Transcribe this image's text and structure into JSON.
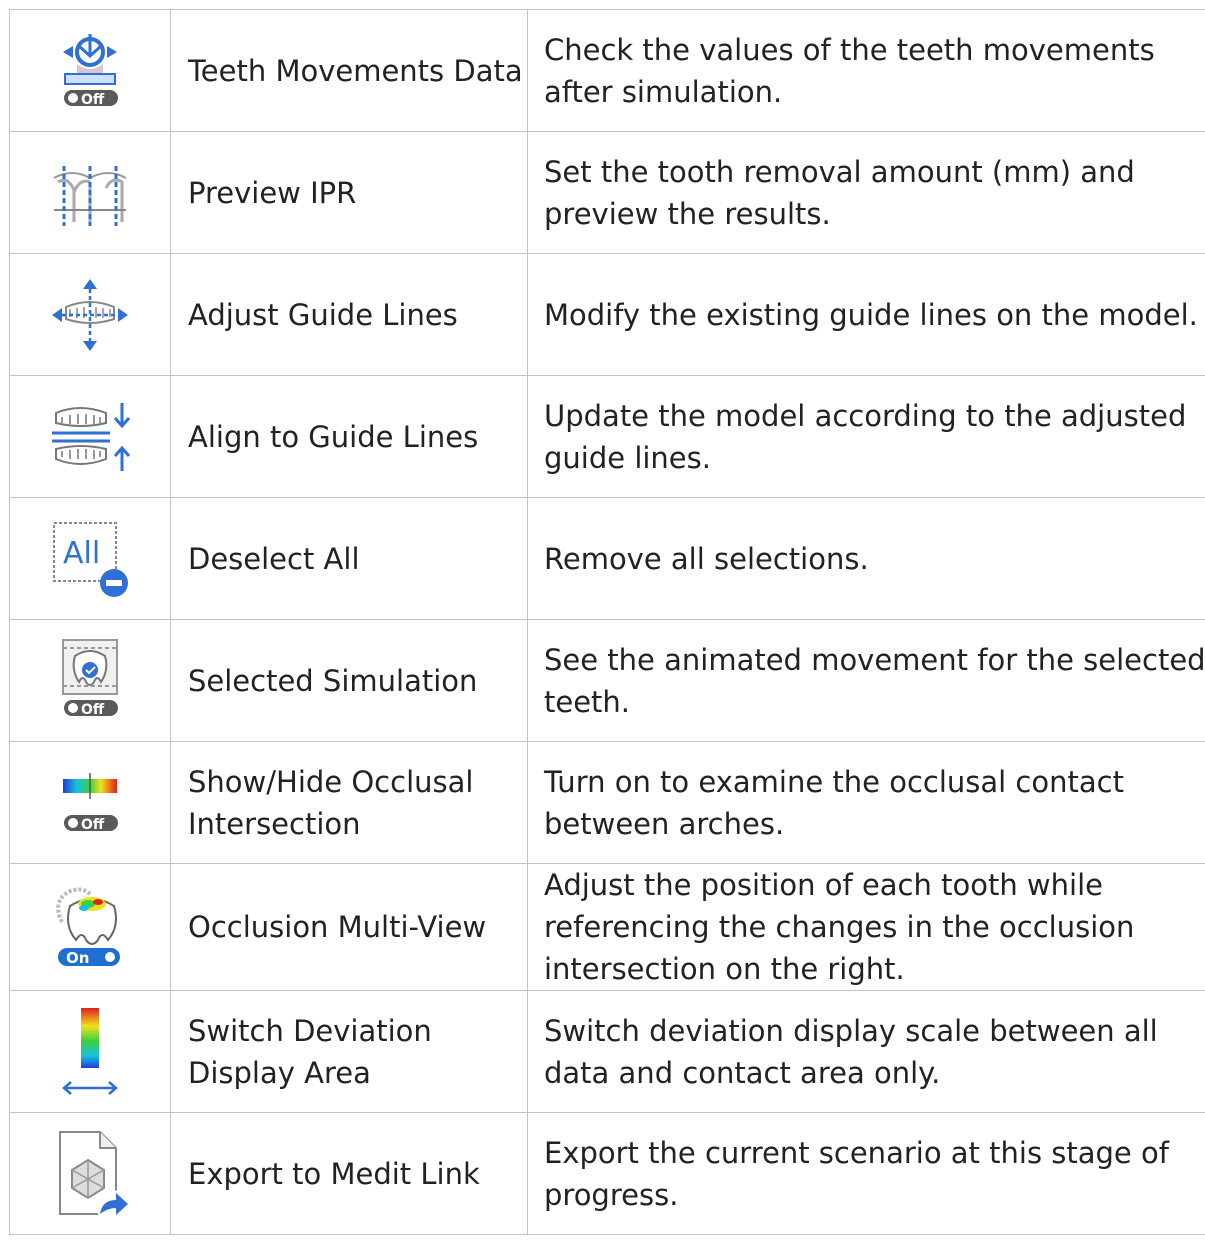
{
  "rows": [
    {
      "icon": "teeth-movements-data-icon",
      "name": "Teeth Movements Data",
      "description": "Check the values of the teeth movements after simulation.",
      "toggle": "Off"
    },
    {
      "icon": "preview-ipr-icon",
      "name": "Preview IPR",
      "description": "Set the tooth removal amount (mm) and preview the results."
    },
    {
      "icon": "adjust-guide-lines-icon",
      "name": "Adjust Guide Lines",
      "description": "Modify the existing guide lines on the model."
    },
    {
      "icon": "align-to-guide-lines-icon",
      "name": "Align to Guide Lines",
      "description": "Update the model according to the adjusted guide lines."
    },
    {
      "icon": "deselect-all-icon",
      "name": "Deselect All",
      "description": "Remove all selections.",
      "icon_text": "All"
    },
    {
      "icon": "selected-simulation-icon",
      "name": "Selected Simulation",
      "description": "See the animated movement for the selected teeth.",
      "toggle": "Off"
    },
    {
      "icon": "occlusal-intersection-icon",
      "name": "Show/Hide Occlusal Intersection",
      "description": "Turn on to examine the occlusal contact between arches.",
      "toggle": "Off"
    },
    {
      "icon": "occlusion-multi-view-icon",
      "name": "Occlusion Multi-View",
      "description": "Adjust the position of each tooth while referencing the changes in the occlusion intersection on the right.",
      "toggle": "On"
    },
    {
      "icon": "switch-deviation-icon",
      "name": "Switch Deviation Display Area",
      "description": "Switch deviation display scale between all data and contact area only."
    },
    {
      "icon": "export-medit-link-icon",
      "name": "Export to Medit Link",
      "description": "Export the current scenario at this stage of progress."
    }
  ],
  "colors": {
    "accent": "#2f6fd6",
    "border": "#c4c4c4",
    "toggle_off": "#5a5a5a",
    "toggle_on": "#1f6fd0"
  }
}
